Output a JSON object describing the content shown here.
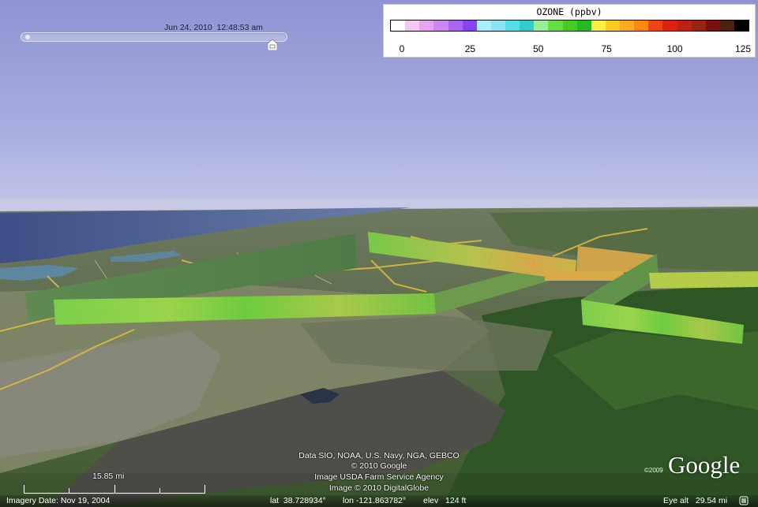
{
  "time_slider": {
    "timestamp": "Jun 24, 2010  12:48:53 am",
    "position": 0.95
  },
  "legend": {
    "title": "OZONE (ppbv)",
    "colors": [
      "#ffffff",
      "#f4c8f4",
      "#e6a4f0",
      "#cc88ee",
      "#aa66ee",
      "#8844ee",
      "#aaeeff",
      "#88e4f4",
      "#55dde8",
      "#33cccc",
      "#99ee99",
      "#66dd44",
      "#44cc22",
      "#22bb22",
      "#ffee44",
      "#ffcc22",
      "#ffaa22",
      "#ff8811",
      "#ee4411",
      "#dd2211",
      "#bb2211",
      "#992211",
      "#771111",
      "#4a2211",
      "#000000"
    ],
    "ticks": [
      "0",
      "25",
      "50",
      "75",
      "100",
      "125"
    ]
  },
  "attribution": {
    "line1": "Data SIO, NOAA, U.S. Navy, NGA, GEBCO",
    "line2": "© 2010 Google",
    "line3": "Image USDA Farm Service Agency",
    "line4": "Image © 2010 DigitalGlobe"
  },
  "logo": {
    "text": "Google",
    "year": "©2009"
  },
  "scale": {
    "label": "15.85 mi"
  },
  "status": {
    "imagery_date": "Imagery Date: Nov 19, 2004",
    "lat": "lat  38.728934°",
    "lon": "lon -121.863782°",
    "elev": "elev   124 ft",
    "eye_alt": "Eye alt   29.54 mi"
  }
}
